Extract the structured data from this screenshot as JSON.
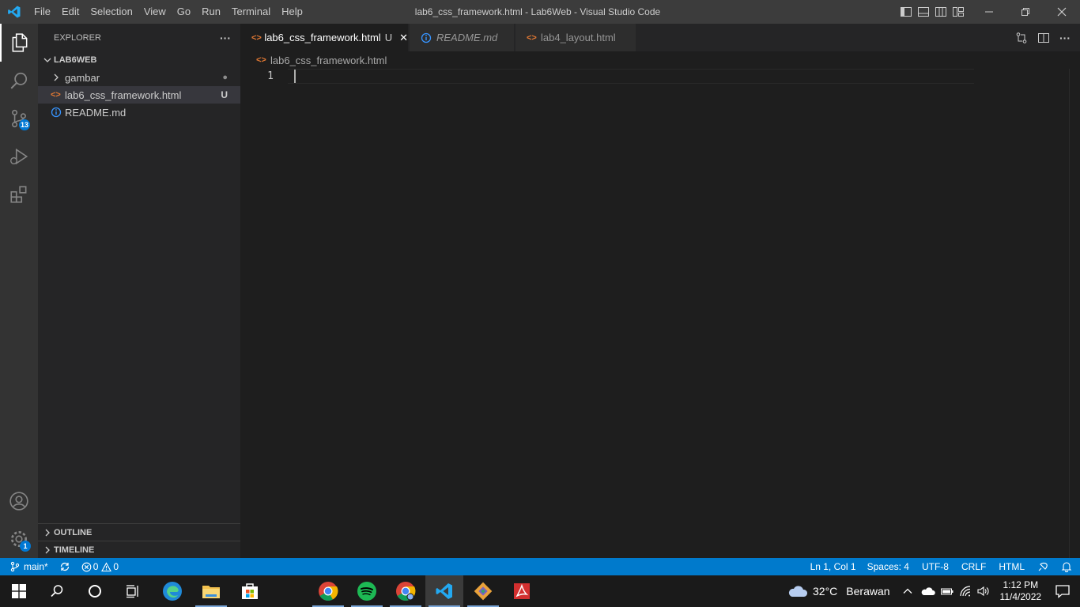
{
  "window": {
    "title": "lab6_css_framework.html - Lab6Web - Visual Studio Code",
    "menu": [
      "File",
      "Edit",
      "Selection",
      "View",
      "Go",
      "Run",
      "Terminal",
      "Help"
    ]
  },
  "activity_bar": {
    "source_control_badge": "13",
    "settings_badge": "1"
  },
  "sidebar": {
    "title": "EXPLORER",
    "more": "···",
    "folder": "LAB6WEB",
    "items": [
      {
        "label": "gambar",
        "kind": "folder",
        "status": "●"
      },
      {
        "label": "lab6_css_framework.html",
        "kind": "html",
        "status": "U"
      },
      {
        "label": "README.md",
        "kind": "info",
        "status": ""
      }
    ],
    "outline": "OUTLINE",
    "timeline": "TIMELINE"
  },
  "tabs": [
    {
      "label": "lab6_css_framework.html",
      "status": "U",
      "close": "✕",
      "active": true
    },
    {
      "label": "README.md",
      "active": false
    },
    {
      "label": "lab4_layout.html",
      "active": false
    }
  ],
  "breadcrumb": "lab6_css_framework.html",
  "editor": {
    "line_number": "1"
  },
  "statusbar": {
    "branch": "main*",
    "errors": "0",
    "warnings": "0",
    "position": "Ln 1, Col 1",
    "spaces": "Spaces: 4",
    "encoding": "UTF-8",
    "eol": "CRLF",
    "language": "HTML"
  },
  "taskbar": {
    "weather_temp": "32°C",
    "weather_text": "Berawan",
    "time": "1:12 PM",
    "date": "11/4/2022"
  },
  "colors": {
    "accent": "#007acc",
    "html_icon": "#e37933",
    "info_icon": "#3794ff",
    "git_untracked": "#73c991"
  }
}
